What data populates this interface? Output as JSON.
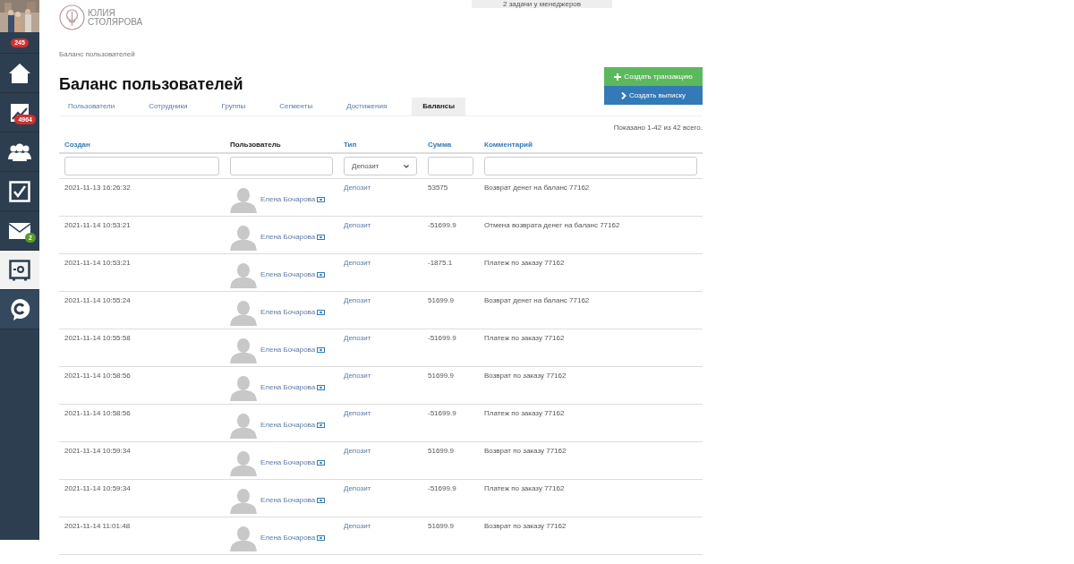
{
  "sidebar": {
    "badge": "245",
    "items": [
      {
        "kind": "home",
        "selected": false
      },
      {
        "kind": "chart",
        "selected": false,
        "badge": "4964",
        "color": "#d0302f"
      },
      {
        "kind": "users",
        "selected": false
      },
      {
        "kind": "tasks",
        "selected": false
      },
      {
        "kind": "mail",
        "selected": false,
        "badge": "2",
        "color": "#5a9a2c"
      },
      {
        "kind": "safe",
        "selected": true
      },
      {
        "kind": "chat",
        "selected": false
      }
    ]
  },
  "top_notice": "2 задачи у менеджеров",
  "logo": {
    "line1": "ЮЛИЯ",
    "line2": "СТОЛЯРОВА"
  },
  "breadcrumb": "Баланс пользователей",
  "title": "Баланс пользователей",
  "actions": [
    {
      "kind": "create",
      "label": "Создать транзакцию"
    },
    {
      "kind": "statement",
      "label": "Создать выписку"
    }
  ],
  "tabs": [
    {
      "label": "Пользователи",
      "selected": false
    },
    {
      "label": "Сотрудники",
      "selected": false
    },
    {
      "label": "Группы",
      "selected": false
    },
    {
      "label": "Сегменты",
      "selected": false
    },
    {
      "label": "Достижения",
      "selected": false
    },
    {
      "label": "Балансы",
      "selected": true
    }
  ],
  "summary": "Показано 1-42 из 42 всего.",
  "table": {
    "columns": [
      {
        "label": "Создан",
        "sortable": true
      },
      {
        "label": "Пользователь",
        "sortable": false
      },
      {
        "label": "Тип",
        "sortable": true
      },
      {
        "label": "Сумма",
        "sortable": true
      },
      {
        "label": "Комментарий",
        "sortable": true
      }
    ],
    "filters": {
      "type_value": "Депозит"
    },
    "rows": [
      {
        "created": "2021-11-13 16:26:32",
        "user": "Елена Бочарова",
        "type": "Депозит",
        "amount": "53575",
        "comment": "Возврат денег на баланс 77162"
      },
      {
        "created": "2021-11-14 10:53:21",
        "user": "Елена Бочарова",
        "type": "Депозит",
        "amount": "-51699.9",
        "comment": "Отмена возврата денег на баланс 77162"
      },
      {
        "created": "2021-11-14 10:53:21",
        "user": "Елена Бочарова",
        "type": "Депозит",
        "amount": "-1875.1",
        "comment": "Платеж по заказу 77162"
      },
      {
        "created": "2021-11-14 10:55:24",
        "user": "Елена Бочарова",
        "type": "Депозит",
        "amount": "51699.9",
        "comment": "Возврат денег на баланс 77162"
      },
      {
        "created": "2021-11-14 10:55:58",
        "user": "Елена Бочарова",
        "type": "Депозит",
        "amount": "-51699.9",
        "comment": "Платеж по заказу 77162"
      },
      {
        "created": "2021-11-14 10:58:56",
        "user": "Елена Бочарова",
        "type": "Депозит",
        "amount": "51699.9",
        "comment": "Возврат по заказу 77162"
      },
      {
        "created": "2021-11-14 10:58:56",
        "user": "Елена Бочарова",
        "type": "Депозит",
        "amount": "-51699.9",
        "comment": "Платеж по заказу 77162"
      },
      {
        "created": "2021-11-14 10:59:34",
        "user": "Елена Бочарова",
        "type": "Депозит",
        "amount": "51699.9",
        "comment": "Возврат по заказу 77162"
      },
      {
        "created": "2021-11-14 10:59:34",
        "user": "Елена Бочарова",
        "type": "Депозит",
        "amount": "-51699.9",
        "comment": "Платеж по заказу 77162"
      },
      {
        "created": "2021-11-14 11:01:48",
        "user": "Елена Бочарова",
        "type": "Депозит",
        "amount": "51699.9",
        "comment": "Возврат по заказу 77162"
      }
    ]
  }
}
